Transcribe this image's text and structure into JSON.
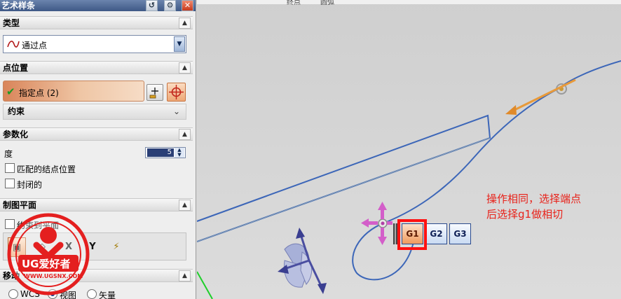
{
  "dialog": {
    "title": "艺术样条",
    "title_buttons": [
      "reset-icon",
      "gear-icon",
      "close-icon"
    ]
  },
  "sections": {
    "type": {
      "header": "类型",
      "selected": "通过点"
    },
    "point_position": {
      "header": "点位置",
      "specify_point_label": "指定点 (2)",
      "constraint_label": "约束"
    },
    "parameterization": {
      "header": "参数化",
      "degree_label": "度",
      "degree_value": "5",
      "match_knot_label": "匹配的结点位置",
      "closed_label": "封闭的"
    },
    "drawing_plane": {
      "header": "制图平面",
      "constrain_to_plane_label": "约束到平面",
      "axis_x": "X",
      "axis_y": "Y"
    },
    "move": {
      "header": "移动",
      "options": [
        "WCS",
        "视图",
        "矢量"
      ],
      "selected": "视图"
    }
  },
  "viewport": {
    "top_labels": [
      "终点",
      "圆弧"
    ],
    "annotation_line1": "操作相同，选择端点",
    "annotation_line2": "后选择g1做相切",
    "continuity_buttons": [
      "G1",
      "G2",
      "G3"
    ],
    "selected_continuity": "G1"
  },
  "watermark": {
    "text": "UG爱好者",
    "url": "WWW.UGSNX.COM"
  },
  "colors": {
    "curve": "#3c66b8",
    "annotation": "#e8221a",
    "highlight": "#ff1111",
    "selected_row": "#e9a97f"
  }
}
